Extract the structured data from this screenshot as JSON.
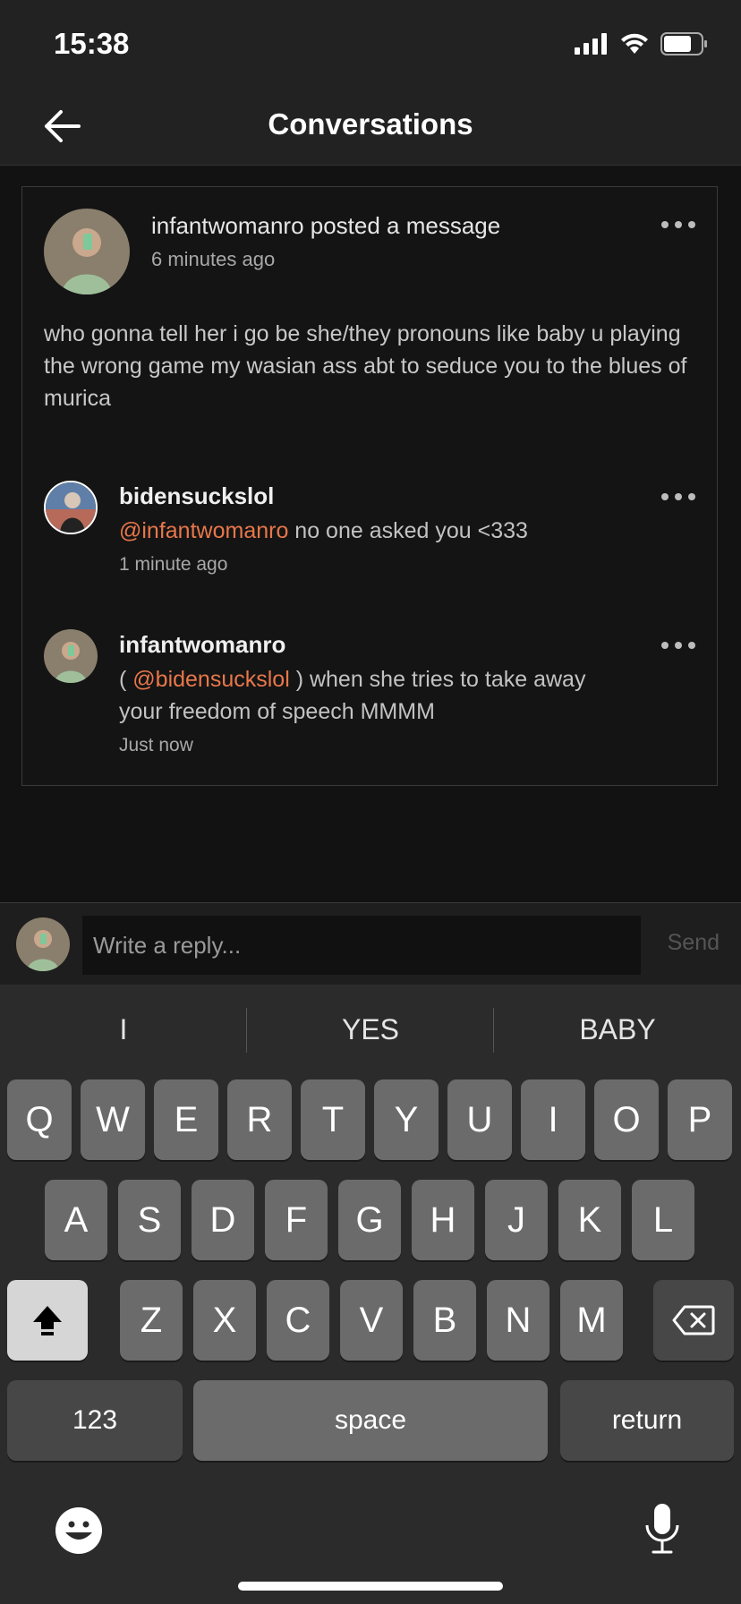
{
  "status": {
    "time": "15:38"
  },
  "nav": {
    "title": "Conversations"
  },
  "post": {
    "title": "infantwomanro posted a message",
    "time": "6 minutes ago",
    "body": "who gonna tell her i go be she/they pronouns like baby u playing the wrong game my wasian ass abt to seduce you to the blues of murica"
  },
  "comments": [
    {
      "name": "bidensuckslol",
      "prefix": "",
      "mention": "@infantwomanro",
      "text": " no one asked you <333",
      "time": "1 minute ago"
    },
    {
      "name": "infantwomanro",
      "prefix": "( ",
      "mention": "@bidensuckslol",
      "text": " ) when she tries to take away your freedom of speech MMMM",
      "time": "Just now"
    }
  ],
  "reply": {
    "placeholder": "Write a reply...",
    "send_label": "Send"
  },
  "keyboard": {
    "suggestions": [
      "I",
      "YES",
      "BABY"
    ],
    "row1": [
      "Q",
      "W",
      "E",
      "R",
      "T",
      "Y",
      "U",
      "I",
      "O",
      "P"
    ],
    "row2": [
      "A",
      "S",
      "D",
      "F",
      "G",
      "H",
      "J",
      "K",
      "L"
    ],
    "row3": [
      "Z",
      "X",
      "C",
      "V",
      "B",
      "N",
      "M"
    ],
    "numbers_label": "123",
    "space_label": "space",
    "return_label": "return"
  },
  "colors": {
    "mention": "#e8774a",
    "background": "#121212",
    "header": "#222222"
  },
  "icons": [
    "back-arrow-icon",
    "signal-icon",
    "wifi-icon",
    "battery-icon",
    "more-icon",
    "shift-icon",
    "delete-icon",
    "emoji-icon",
    "microphone-icon"
  ]
}
